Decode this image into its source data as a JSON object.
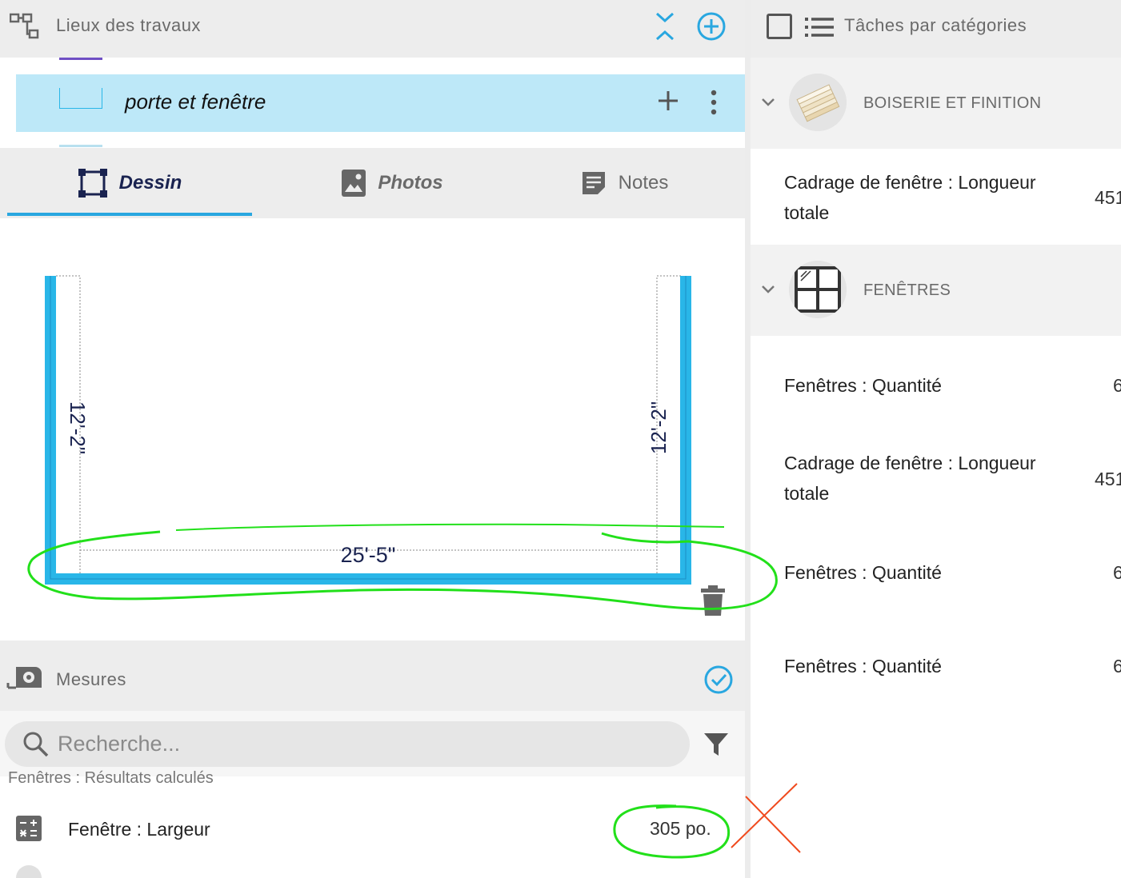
{
  "left_panel": {
    "locations_title": "Lieux des travaux",
    "selected_location": "porte et fenêtre",
    "tabs": [
      {
        "label": "Dessin",
        "active": true
      },
      {
        "label": "Photos",
        "active": false
      },
      {
        "label": "Notes",
        "active": false
      }
    ],
    "drawing": {
      "wall_color": "#29b6e8",
      "dimensions": {
        "left_wall": "12'-2\"",
        "right_wall": "12'-2\"",
        "bottom_wall": "25'-5\""
      }
    },
    "measures": {
      "title": "Mesures",
      "search_placeholder": "Recherche...",
      "group_label": "Fenêtres : Résultats calculés",
      "results": [
        {
          "label": "Fenêtre : Largeur",
          "value": "305 po.",
          "icon": "calculator-icon"
        }
      ]
    }
  },
  "right_panel": {
    "title": "Tâches par catégories",
    "categories": [
      {
        "title": "BOISERIE ET FINITION",
        "icon": "wood-boards-icon",
        "tasks": [
          {
            "label": "Cadrage de fenêtre : Longueur totale",
            "value": "451"
          }
        ]
      },
      {
        "title": "FENÊTRES",
        "icon": "window-icon",
        "tasks": [
          {
            "label": "Fenêtres : Quantité",
            "value": "6"
          },
          {
            "label": "Cadrage de fenêtre : Longueur totale",
            "value": "451"
          },
          {
            "label": "Fenêtres : Quantité",
            "value": "6"
          },
          {
            "label": "Fenêtres : Quantité",
            "value": "6"
          }
        ]
      }
    ]
  },
  "colors": {
    "accent": "#29a7e0",
    "selected_row": "#bde8f8",
    "annotation_green": "#22e01a",
    "annotation_red": "#f04a1e"
  }
}
